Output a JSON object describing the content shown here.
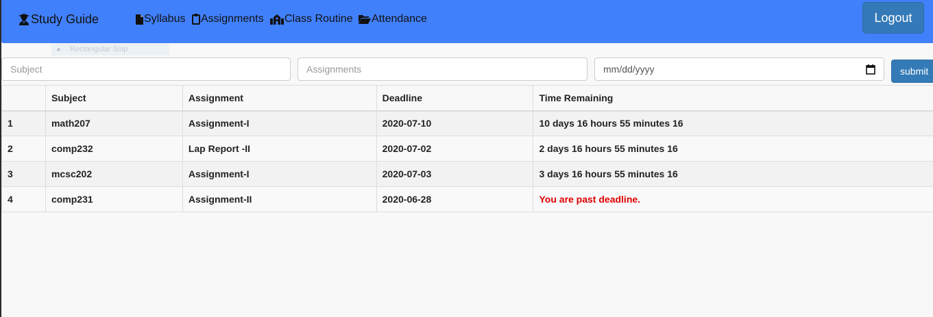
{
  "navbar": {
    "brand": "Study Guide",
    "brand_icon": "graduate-icon",
    "links": [
      {
        "label": "Syllabus",
        "icon": "file-icon"
      },
      {
        "label": "Assignments",
        "icon": "clipboard-icon"
      },
      {
        "label": "Class Routine",
        "icon": "school-icon"
      },
      {
        "label": "Attendance",
        "icon": "folder-open-icon"
      }
    ],
    "logout_label": "Logout",
    "color": "#4180fb"
  },
  "overlay": {
    "text": "Rectangular Snip"
  },
  "form": {
    "subject_placeholder": "Subject",
    "assignments_placeholder": "Assignments",
    "date_placeholder": "mm/dd/yyyy",
    "submit_label": "submit"
  },
  "table": {
    "headers": [
      "",
      "Subject",
      "Assignment",
      "Deadline",
      "Time Remaining"
    ],
    "rows": [
      {
        "num": "1",
        "subject": "math207",
        "assignment": "Assignment-I",
        "deadline": "2020-07-10",
        "remaining": "10 days 16 hours 55 minutes 16"
      },
      {
        "num": "2",
        "subject": "comp232",
        "assignment": "Lap Report -II",
        "deadline": "2020-07-02",
        "remaining": "2 days 16 hours 55 minutes 16"
      },
      {
        "num": "3",
        "subject": "mcsc202",
        "assignment": "Assignment-I",
        "deadline": "2020-07-03",
        "remaining": "3 days 16 hours 55 minutes 16"
      },
      {
        "num": "4",
        "subject": "comp231",
        "assignment": "Assignment-II",
        "deadline": "2020-06-28",
        "remaining": "You are past deadline."
      }
    ],
    "past_color": "#e00000"
  }
}
